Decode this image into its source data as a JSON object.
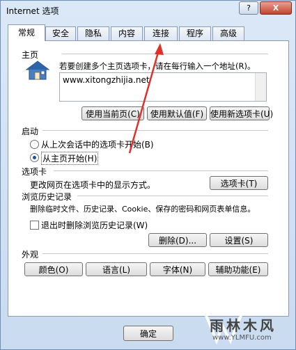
{
  "window": {
    "title": "Internet 选项",
    "help_label": "?",
    "close_label": "X"
  },
  "tabs": [
    {
      "label": "常规"
    },
    {
      "label": "安全"
    },
    {
      "label": "隐私"
    },
    {
      "label": "内容"
    },
    {
      "label": "连接"
    },
    {
      "label": "程序"
    },
    {
      "label": "高级"
    }
  ],
  "home": {
    "section_title": "主页",
    "description": "若要创建多个主页选项卡，请在每行输入一个地址(R)。",
    "url": "www.xitongzhijia.net",
    "buttons": [
      "使用当前页(C)",
      "使用默认值(F)",
      "使用新选项卡(U)"
    ]
  },
  "startup": {
    "section_title": "启动",
    "options": [
      "从上次会话中的选项卡开始(B)",
      "从主页开始(H)"
    ],
    "selected": 1
  },
  "tabs_section": {
    "section_title": "选项卡",
    "description": "更改网页在选项卡中的显示方式。",
    "button": "选项卡(T)"
  },
  "history": {
    "section_title": "浏览历史记录",
    "description": "删除临时文件、历史记录、Cookie、保存的密码和网页表单信息。",
    "checkbox_label": "退出时删除浏览历史记录(W)",
    "delete_button": "删除(D)...",
    "settings_button": "设置(S)"
  },
  "appearance": {
    "section_title": "外观",
    "buttons": [
      "颜色(O)",
      "语言(L)",
      "字体(N)",
      "辅助功能(E)"
    ]
  },
  "footer": {
    "ok_button": "确定"
  },
  "watermark": {
    "brand": "雨林木风",
    "url": "www.YLMFU.com"
  }
}
